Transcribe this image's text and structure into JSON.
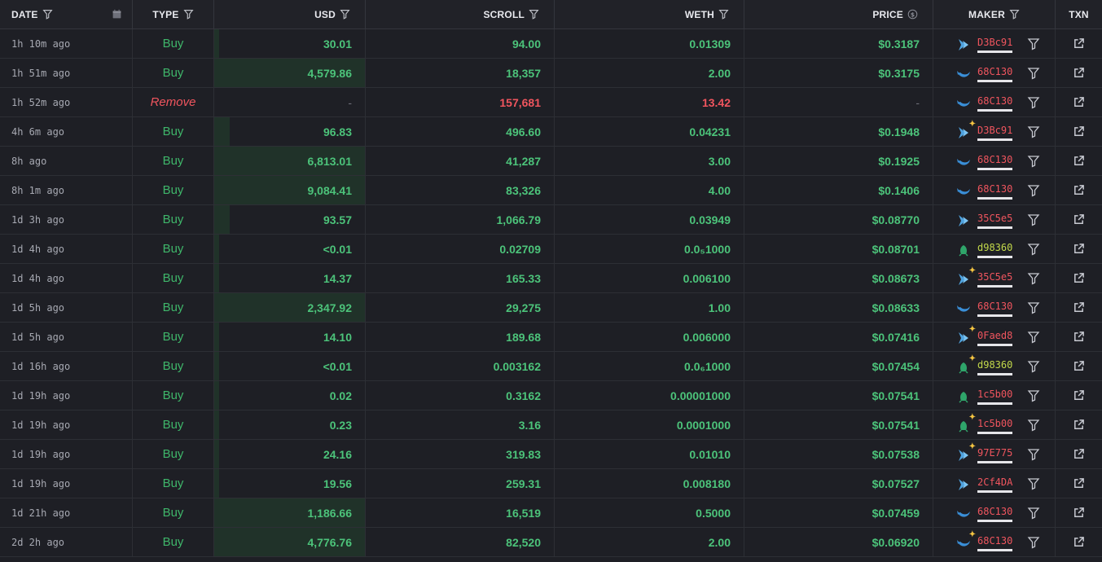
{
  "headers": {
    "date": "DATE",
    "type": "TYPE",
    "usd": "USD",
    "scroll": "SCROLL",
    "weth": "WETH",
    "price": "PRICE",
    "maker": "MAKER",
    "txn": "TXN"
  },
  "colors": {
    "buy": "#3fb66a",
    "remove": "#f0555e",
    "value_green": "#4cc37a",
    "value_red": "#f0555e",
    "usd_bar": "#203229"
  },
  "rows": [
    {
      "date": "1h 10m ago",
      "type": "Buy",
      "usd": "30.01",
      "usd_fill": 0.03,
      "scroll": "94.00",
      "weth": "0.01309",
      "price": "$0.3187",
      "maker": "D3Bc91",
      "maker_color": "#f0555e",
      "icon": "dolphin-icon",
      "sparkle": false
    },
    {
      "date": "1h 51m ago",
      "type": "Buy",
      "usd": "4,579.86",
      "usd_fill": 1,
      "scroll": "18,357",
      "weth": "2.00",
      "price": "$0.3175",
      "maker": "68C130",
      "maker_color": "#f0555e",
      "icon": "whale-icon",
      "sparkle": false
    },
    {
      "date": "1h 52m ago",
      "type": "Remove",
      "usd": "-",
      "usd_fill": 0,
      "scroll": "157,681",
      "weth": "13.42",
      "price": "-",
      "maker": "68C130",
      "maker_color": "#f0555e",
      "icon": "whale-icon",
      "sparkle": false
    },
    {
      "date": "4h 6m ago",
      "type": "Buy",
      "usd": "96.83",
      "usd_fill": 0.1,
      "scroll": "496.60",
      "weth": "0.04231",
      "price": "$0.1948",
      "maker": "D3Bc91",
      "maker_color": "#f0555e",
      "icon": "dolphin-icon",
      "sparkle": true
    },
    {
      "date": "8h ago",
      "type": "Buy",
      "usd": "6,813.01",
      "usd_fill": 1,
      "scroll": "41,287",
      "weth": "3.00",
      "price": "$0.1925",
      "maker": "68C130",
      "maker_color": "#f0555e",
      "icon": "whale-icon",
      "sparkle": false
    },
    {
      "date": "8h 1m ago",
      "type": "Buy",
      "usd": "9,084.41",
      "usd_fill": 1,
      "scroll": "83,326",
      "weth": "4.00",
      "price": "$0.1406",
      "maker": "68C130",
      "maker_color": "#f0555e",
      "icon": "whale-icon",
      "sparkle": false
    },
    {
      "date": "1d 3h ago",
      "type": "Buy",
      "usd": "93.57",
      "usd_fill": 0.1,
      "scroll": "1,066.79",
      "weth": "0.03949",
      "price": "$0.08770",
      "maker": "35C5e5",
      "maker_color": "#f0555e",
      "icon": "dolphin-icon",
      "sparkle": false
    },
    {
      "date": "1d 4h ago",
      "type": "Buy",
      "usd": "<0.01",
      "usd_fill": 0.01,
      "scroll": "0.02709",
      "weth": "0.0₅1000",
      "price": "$0.08701",
      "maker": "d98360",
      "maker_color": "#c3d94a",
      "icon": "shrimp-icon",
      "sparkle": false
    },
    {
      "date": "1d 4h ago",
      "type": "Buy",
      "usd": "14.37",
      "usd_fill": 0.02,
      "scroll": "165.33",
      "weth": "0.006100",
      "price": "$0.08673",
      "maker": "35C5e5",
      "maker_color": "#f0555e",
      "icon": "dolphin-icon",
      "sparkle": true
    },
    {
      "date": "1d 5h ago",
      "type": "Buy",
      "usd": "2,347.92",
      "usd_fill": 1,
      "scroll": "29,275",
      "weth": "1.00",
      "price": "$0.08633",
      "maker": "68C130",
      "maker_color": "#f0555e",
      "icon": "whale-icon",
      "sparkle": false
    },
    {
      "date": "1d 5h ago",
      "type": "Buy",
      "usd": "14.10",
      "usd_fill": 0.02,
      "scroll": "189.68",
      "weth": "0.006000",
      "price": "$0.07416",
      "maker": "0Faed8",
      "maker_color": "#f0555e",
      "icon": "dolphin-icon",
      "sparkle": true
    },
    {
      "date": "1d 16h ago",
      "type": "Buy",
      "usd": "<0.01",
      "usd_fill": 0.01,
      "scroll": "0.003162",
      "weth": "0.0₆1000",
      "price": "$0.07454",
      "maker": "d98360",
      "maker_color": "#c3d94a",
      "icon": "shrimp-icon",
      "sparkle": true
    },
    {
      "date": "1d 19h ago",
      "type": "Buy",
      "usd": "0.02",
      "usd_fill": 0.01,
      "scroll": "0.3162",
      "weth": "0.00001000",
      "price": "$0.07541",
      "maker": "1c5b00",
      "maker_color": "#f0555e",
      "icon": "shrimp-icon",
      "sparkle": false
    },
    {
      "date": "1d 19h ago",
      "type": "Buy",
      "usd": "0.23",
      "usd_fill": 0.01,
      "scroll": "3.16",
      "weth": "0.0001000",
      "price": "$0.07541",
      "maker": "1c5b00",
      "maker_color": "#f0555e",
      "icon": "shrimp-icon",
      "sparkle": true
    },
    {
      "date": "1d 19h ago",
      "type": "Buy",
      "usd": "24.16",
      "usd_fill": 0.03,
      "scroll": "319.83",
      "weth": "0.01010",
      "price": "$0.07538",
      "maker": "97E775",
      "maker_color": "#f0555e",
      "icon": "dolphin-icon",
      "sparkle": true
    },
    {
      "date": "1d 19h ago",
      "type": "Buy",
      "usd": "19.56",
      "usd_fill": 0.02,
      "scroll": "259.31",
      "weth": "0.008180",
      "price": "$0.07527",
      "maker": "2Cf4DA",
      "maker_color": "#f0555e",
      "icon": "dolphin-icon",
      "sparkle": false
    },
    {
      "date": "1d 21h ago",
      "type": "Buy",
      "usd": "1,186.66",
      "usd_fill": 1,
      "scroll": "16,519",
      "weth": "0.5000",
      "price": "$0.07459",
      "maker": "68C130",
      "maker_color": "#f0555e",
      "icon": "whale-icon",
      "sparkle": false
    },
    {
      "date": "2d 2h ago",
      "type": "Buy",
      "usd": "4,776.76",
      "usd_fill": 1,
      "scroll": "82,520",
      "weth": "2.00",
      "price": "$0.06920",
      "maker": "68C130",
      "maker_color": "#f0555e",
      "icon": "whale-icon",
      "sparkle": true
    }
  ]
}
